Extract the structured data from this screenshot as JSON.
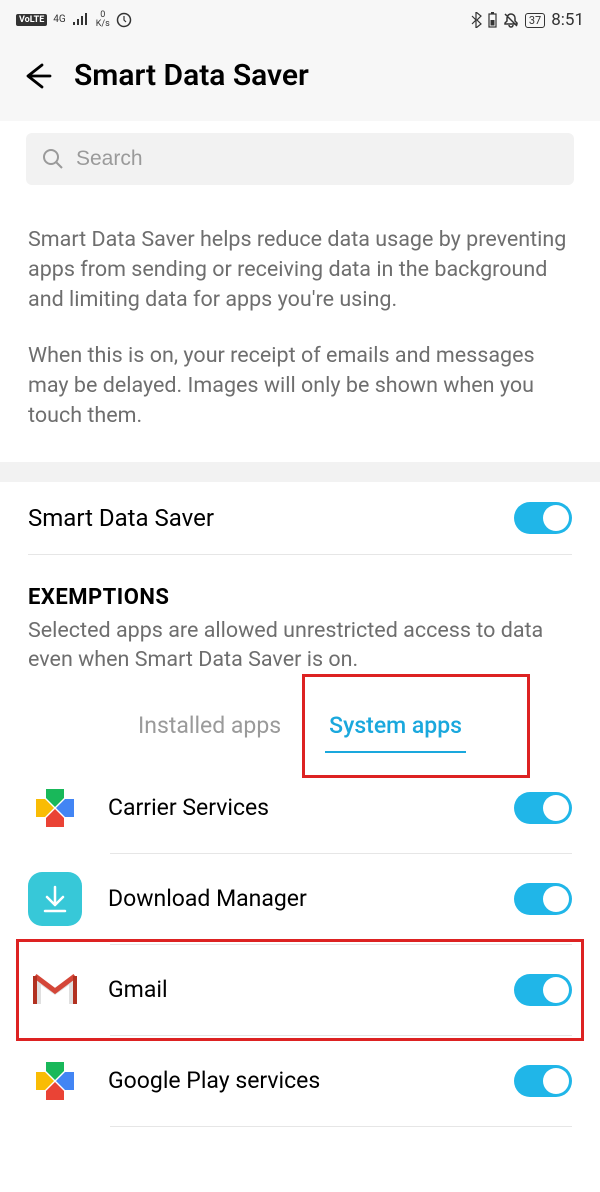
{
  "status": {
    "volte": "VoLTE",
    "net": "4G",
    "speed_top": "0",
    "speed_unit": "K/s",
    "battery": "37",
    "time": "8:51"
  },
  "header": {
    "title": "Smart Data Saver"
  },
  "search": {
    "placeholder": "Search"
  },
  "description": {
    "p1": "Smart Data Saver helps reduce data usage by preventing apps from sending or receiving data in the background and limiting data for apps you're using.",
    "p2": "When this is on, your receipt of emails and messages may be delayed. Images will only be shown when you touch them."
  },
  "main_toggle": {
    "label": "Smart Data Saver"
  },
  "exemptions": {
    "title": "EXEMPTIONS",
    "subtitle": "Selected apps are allowed unrestricted access to data even when Smart Data Saver is on."
  },
  "tabs": {
    "installed": "Installed apps",
    "system": "System apps"
  },
  "apps": [
    {
      "name": "Carrier Services"
    },
    {
      "name": "Download Manager"
    },
    {
      "name": "Gmail"
    },
    {
      "name": "Google Play services"
    }
  ]
}
